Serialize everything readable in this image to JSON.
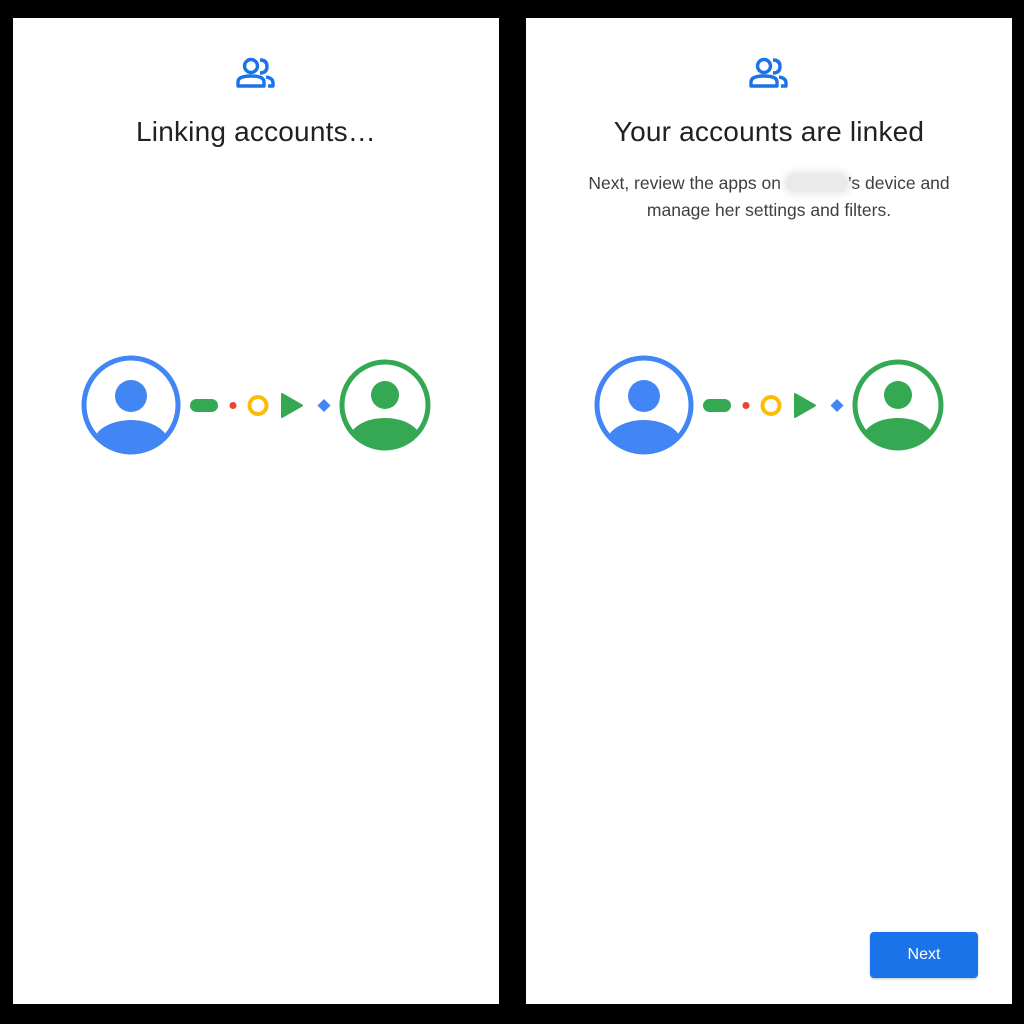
{
  "colors": {
    "blue": "#4285f4",
    "green": "#34a853",
    "red": "#ea4335",
    "yellow": "#fbbc04",
    "accent": "#1a73e8"
  },
  "left_screen": {
    "icon": "family-link-people-icon",
    "title": "Linking accounts…"
  },
  "right_screen": {
    "icon": "family-link-people-icon",
    "title": "Your accounts are linked",
    "subtitle_before_name": "Next, review the apps on ",
    "subtitle_after_name": "’s device and manage her settings and filters.",
    "next_button_label": "Next"
  }
}
